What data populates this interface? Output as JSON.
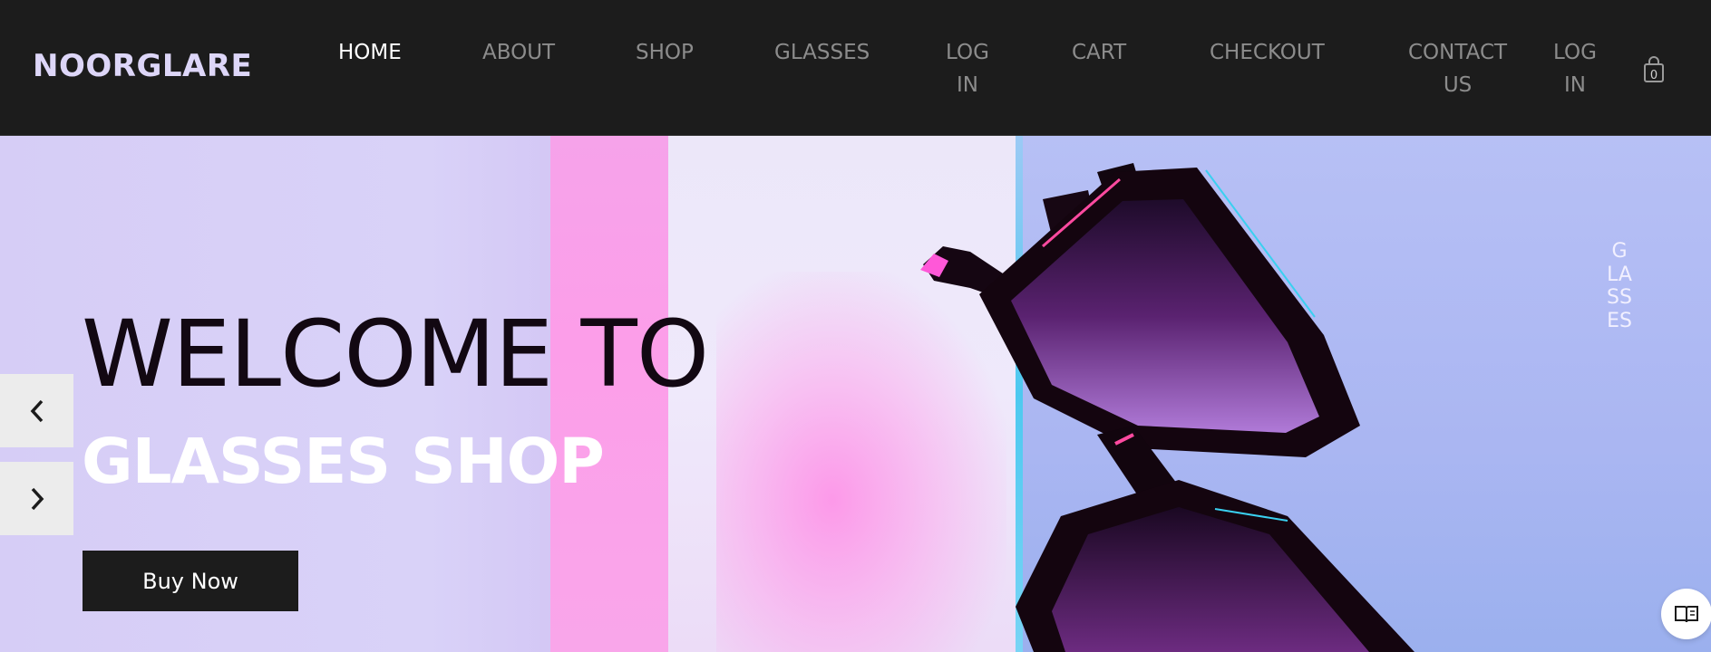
{
  "brand": "NOORGLARE",
  "nav": {
    "items": [
      {
        "label": "HOME"
      },
      {
        "label": "ABOUT"
      },
      {
        "label": "SHOP"
      },
      {
        "label": "GLASSES"
      },
      {
        "label": "LOG\nIN"
      },
      {
        "label": "CART"
      },
      {
        "label": "CHECKOUT"
      },
      {
        "label": "CONTACT\nUS"
      },
      {
        "label": "LOG\nIN"
      }
    ],
    "cart_count": "0"
  },
  "hero": {
    "title": "WELCOME TO",
    "subtitle": "GLASSES SHOP",
    "button_label": "Buy Now",
    "vertical_label": "GLASSES"
  },
  "icons": {
    "cart": "shopping-bag-icon",
    "prev": "chevron-left-icon",
    "next": "chevron-right-icon",
    "reader": "book-open-icon"
  },
  "colors": {
    "nav_bg": "#1c1c1c",
    "brand": "#ddd6f8",
    "hero_title": "#120812",
    "hero_subtitle": "#ffffff",
    "button_bg": "#1c1c1c"
  }
}
